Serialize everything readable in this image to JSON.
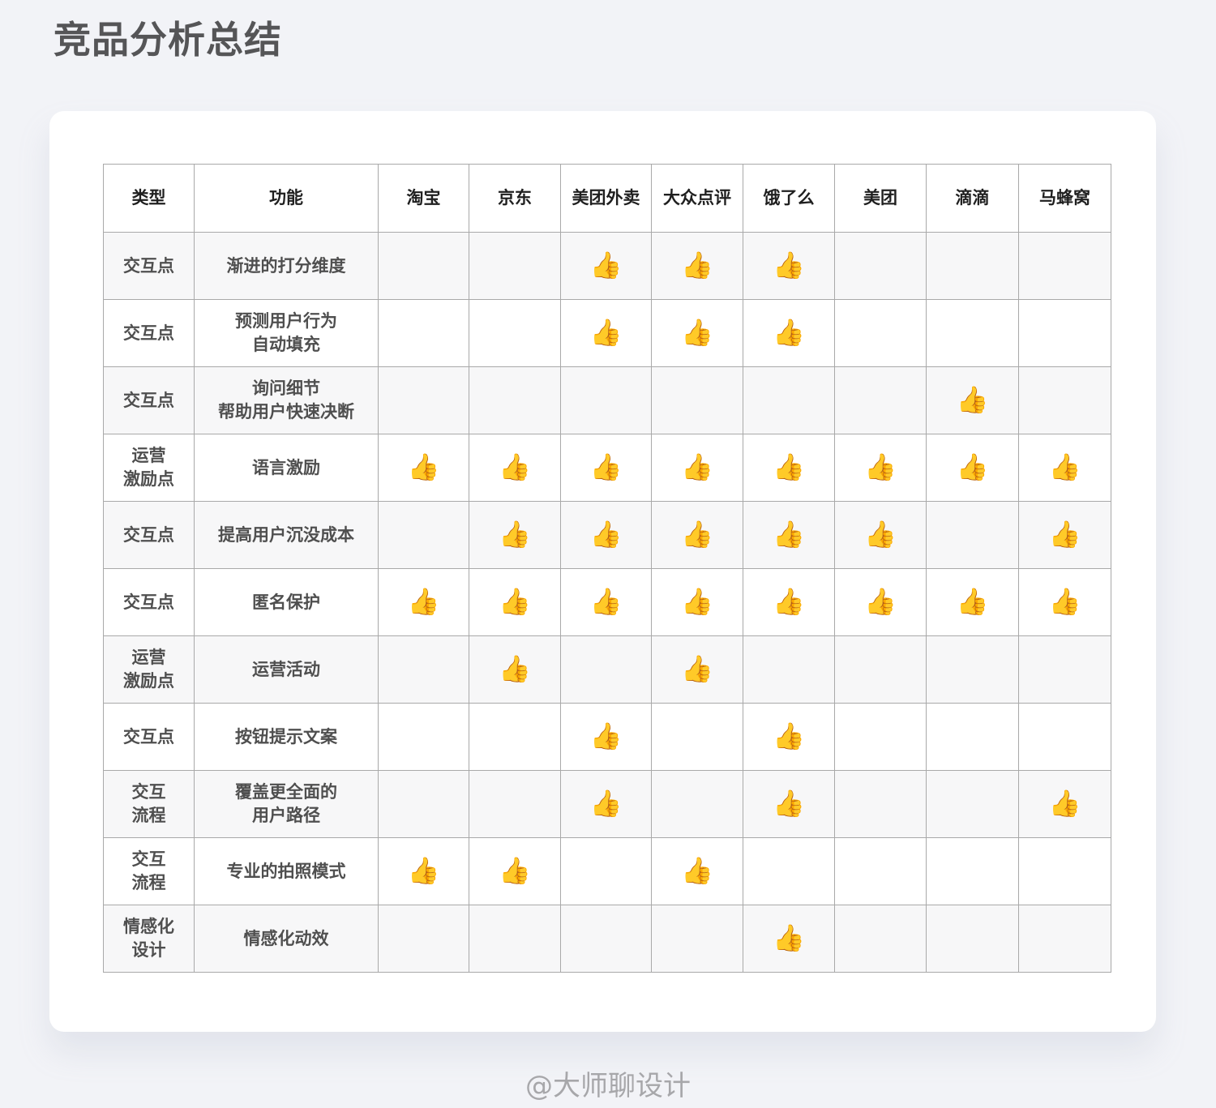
{
  "page": {
    "title": "竞品分析总结",
    "watermark": "@大师聊设计"
  },
  "icons": {
    "check": "thumbs-up-icon",
    "check_glyph": "👍"
  },
  "table": {
    "headers": [
      "类型",
      "功能",
      "淘宝",
      "京东",
      "美团外卖",
      "大众点评",
      "饿了么",
      "美团",
      "滴滴",
      "马蜂窝"
    ],
    "rows": [
      {
        "type": "交互点",
        "feature": "渐进的打分维度",
        "marks": [
          false,
          false,
          true,
          true,
          true,
          false,
          false,
          false
        ]
      },
      {
        "type": "交互点",
        "feature": "预测用户行为\n自动填充",
        "marks": [
          false,
          false,
          true,
          true,
          true,
          false,
          false,
          false
        ]
      },
      {
        "type": "交互点",
        "feature": "询问细节\n帮助用户快速决断",
        "marks": [
          false,
          false,
          false,
          false,
          false,
          false,
          true,
          false
        ]
      },
      {
        "type": "运营\n激励点",
        "feature": "语言激励",
        "marks": [
          true,
          true,
          true,
          true,
          true,
          true,
          true,
          true
        ]
      },
      {
        "type": "交互点",
        "feature": "提高用户沉没成本",
        "marks": [
          false,
          true,
          true,
          true,
          true,
          true,
          false,
          true
        ]
      },
      {
        "type": "交互点",
        "feature": "匿名保护",
        "marks": [
          true,
          true,
          true,
          true,
          true,
          true,
          true,
          true
        ]
      },
      {
        "type": "运营\n激励点",
        "feature": "运营活动",
        "marks": [
          false,
          true,
          false,
          true,
          false,
          false,
          false,
          false
        ]
      },
      {
        "type": "交互点",
        "feature": "按钮提示文案",
        "marks": [
          false,
          false,
          true,
          false,
          true,
          false,
          false,
          false
        ]
      },
      {
        "type": "交互\n流程",
        "feature": "覆盖更全面的\n用户路径",
        "marks": [
          false,
          false,
          true,
          false,
          true,
          false,
          false,
          true
        ]
      },
      {
        "type": "交互\n流程",
        "feature": "专业的拍照模式",
        "marks": [
          true,
          true,
          false,
          true,
          false,
          false,
          false,
          false
        ]
      },
      {
        "type": "情感化\n设计",
        "feature": "情感化动效",
        "marks": [
          false,
          false,
          false,
          false,
          true,
          false,
          false,
          false
        ]
      }
    ]
  }
}
